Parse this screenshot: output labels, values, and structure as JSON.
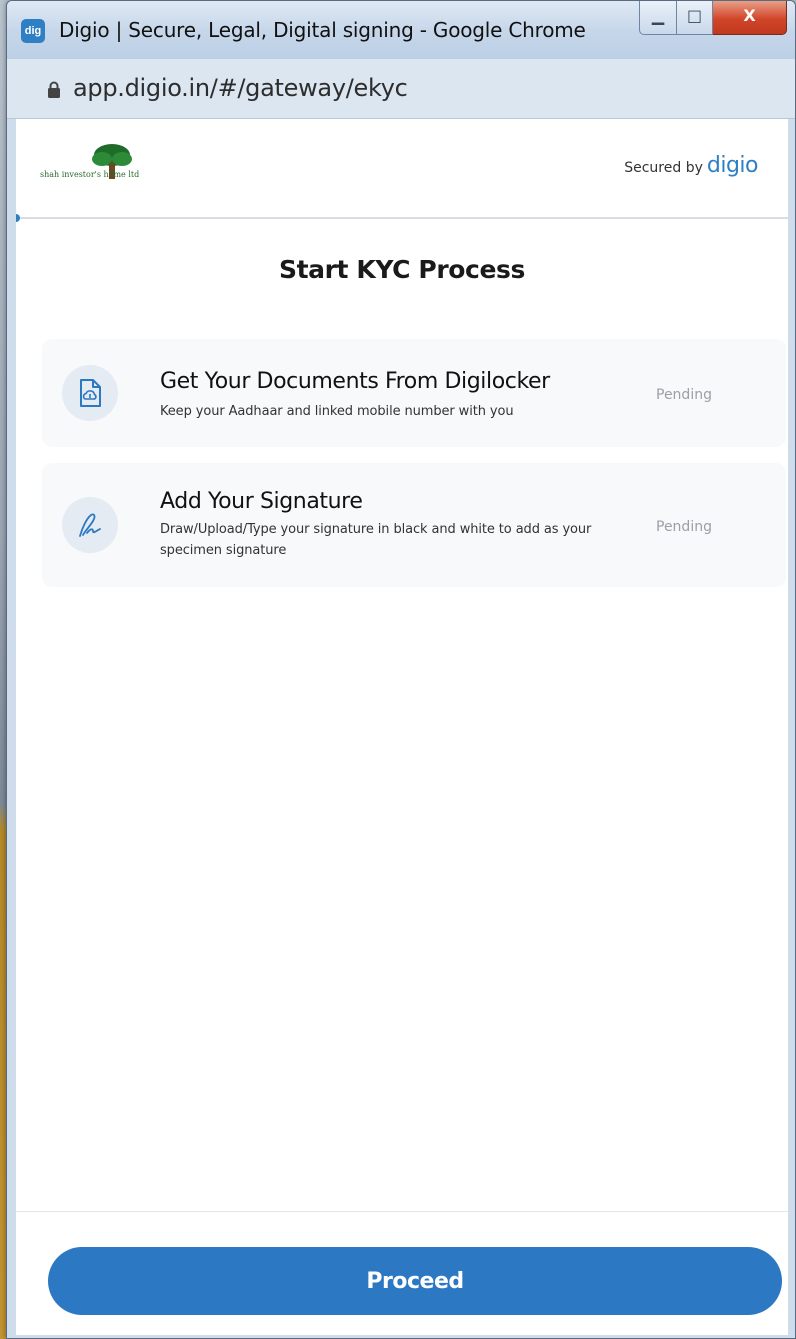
{
  "window": {
    "title": "Digio | Secure, Legal, Digital signing - Google Chrome",
    "app_icon_label": "dig",
    "controls": {
      "minimize": "▁",
      "maximize": "□",
      "close": "X"
    }
  },
  "address_bar": {
    "url": "app.digio.in/#/gateway/ekyc",
    "icon": "lock-icon"
  },
  "header": {
    "logo_text": "shah investor's home ltd",
    "secured_by_label": "Secured by",
    "secured_by_brand": "digio"
  },
  "main": {
    "heading": "Start KYC Process",
    "steps": [
      {
        "icon": "document-cloud-icon",
        "title": "Get Your Documents From Digilocker",
        "description": "Keep your Aadhaar and linked mobile number with you",
        "status": "Pending"
      },
      {
        "icon": "signature-pen-icon",
        "title": "Add Your Signature",
        "description": "Draw/Upload/Type your signature in black and white to add as your specimen signature",
        "status": "Pending"
      }
    ]
  },
  "footer": {
    "proceed_label": "Proceed"
  },
  "colors": {
    "accent": "#2c78c2",
    "card_bg": "#f7f9fb",
    "status_text": "#9aa0a6"
  }
}
